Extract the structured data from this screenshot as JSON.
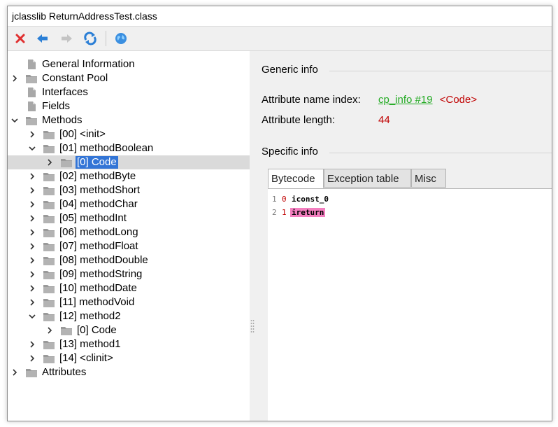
{
  "window": {
    "title": "jclasslib ReturnAddressTest.class"
  },
  "toolbar": {
    "buttons": [
      {
        "icon": "close-icon",
        "color": "#e03030"
      },
      {
        "icon": "back-arrow-icon",
        "color": "#2b7fd6"
      },
      {
        "icon": "forward-arrow-icon",
        "color": "#b8b8b8"
      },
      {
        "icon": "reload-icon",
        "color": "#2b7fd6"
      },
      {
        "icon": "globe-icon",
        "color": "#2b88d8"
      }
    ]
  },
  "tree": {
    "nodes": [
      {
        "label": "General Information",
        "expander": "none",
        "type": "file"
      },
      {
        "label": "Constant Pool",
        "expander": "collapsed",
        "type": "folder"
      },
      {
        "label": "Interfaces",
        "expander": "none",
        "type": "file"
      },
      {
        "label": "Fields",
        "expander": "none",
        "type": "file"
      },
      {
        "label": "Methods",
        "expander": "expanded",
        "type": "folder"
      },
      {
        "label": "[00] <init>",
        "expander": "collapsed",
        "type": "folder"
      },
      {
        "label": "[01] methodBoolean",
        "expander": "expanded",
        "type": "folder"
      },
      {
        "label": "[0] Code",
        "expander": "collapsed",
        "type": "folder",
        "selected": true
      },
      {
        "label": "[02] methodByte",
        "expander": "collapsed",
        "type": "folder"
      },
      {
        "label": "[03] methodShort",
        "expander": "collapsed",
        "type": "folder"
      },
      {
        "label": "[04] methodChar",
        "expander": "collapsed",
        "type": "folder"
      },
      {
        "label": "[05] methodInt",
        "expander": "collapsed",
        "type": "folder"
      },
      {
        "label": "[06] methodLong",
        "expander": "collapsed",
        "type": "folder"
      },
      {
        "label": "[07] methodFloat",
        "expander": "collapsed",
        "type": "folder"
      },
      {
        "label": "[08] methodDouble",
        "expander": "collapsed",
        "type": "folder"
      },
      {
        "label": "[09] methodString",
        "expander": "collapsed",
        "type": "folder"
      },
      {
        "label": "[10] methodDate",
        "expander": "collapsed",
        "type": "folder"
      },
      {
        "label": "[11] methodVoid",
        "expander": "collapsed",
        "type": "folder"
      },
      {
        "label": "[12] method2",
        "expander": "expanded",
        "type": "folder"
      },
      {
        "label": "[0] Code",
        "expander": "collapsed",
        "type": "folder"
      },
      {
        "label": "[13] method1",
        "expander": "collapsed",
        "type": "folder"
      },
      {
        "label": "[14] <clinit>",
        "expander": "collapsed",
        "type": "folder"
      },
      {
        "label": "Attributes",
        "expander": "collapsed",
        "type": "folder"
      }
    ]
  },
  "detail": {
    "generic_title": "Generic info",
    "name_index_label": "Attribute name index:",
    "name_index_link": "cp_info #19",
    "name_index_value": "<Code>",
    "length_label": "Attribute length:",
    "length_value": "44",
    "specific_title": "Specific info",
    "tabs": [
      "Bytecode",
      "Exception table",
      "Misc"
    ],
    "active_tab": "Bytecode",
    "bytecode": [
      {
        "line": "1",
        "offset": "0",
        "instruction": "iconst_0",
        "highlighted": false
      },
      {
        "line": "2",
        "offset": "1",
        "instruction": "ireturn",
        "highlighted": true
      }
    ]
  },
  "colors": {
    "selection": "#3375d6",
    "link": "#22aa22",
    "value": "#c00000",
    "highlight": "#f47fc0"
  }
}
